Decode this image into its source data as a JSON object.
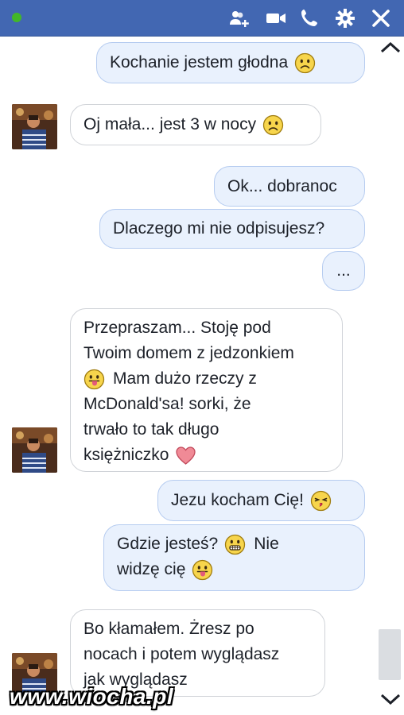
{
  "header": {
    "background": "#4267b2",
    "status_color": "#42b72a",
    "icons": [
      "add-person-icon",
      "video-camera-icon",
      "phone-icon",
      "gear-icon",
      "close-icon"
    ]
  },
  "messages": [
    {
      "from": "me",
      "lines": [
        "Kochanie jestem głodna"
      ],
      "emoji": "sad-face"
    },
    {
      "from": "friend",
      "lines": [
        "Oj mała... jest 3 w nocy"
      ],
      "emoji": "sad-face"
    },
    {
      "from": "me",
      "lines": [
        "Ok... dobranoc"
      ]
    },
    {
      "from": "me",
      "lines": [
        "Dlaczego mi nie odpisujesz?"
      ]
    },
    {
      "from": "me",
      "lines": [
        "..."
      ]
    },
    {
      "from": "friend",
      "lines": [
        "Przepraszam... Stoję pod",
        "Twoim domem z jedzonkiem",
        "Mam dużo rzeczy z",
        "McDonald'sa! sorki, że",
        "trwało to tak długo",
        "księżniczko"
      ],
      "emoji": [
        "tongue-face",
        "heart"
      ]
    },
    {
      "from": "me",
      "lines": [
        "Jezu kocham Cię!"
      ],
      "emoji": "kiss-face"
    },
    {
      "from": "me",
      "lines": [
        "Gdzie jesteś?",
        "Nie",
        "widzę cię"
      ],
      "emoji": [
        "grin-face",
        "tongue-face"
      ]
    },
    {
      "from": "friend",
      "lines": [
        "Bo kłamałem. Żresz po",
        "nocach i potem wyglądasz",
        "jak wyglądasz"
      ]
    }
  ],
  "watermark": "www.wiocha.pl",
  "colors": {
    "outgoing_bubble": "#e9f1fd",
    "outgoing_border": "#b6ccf0",
    "incoming_bubble": "#ffffff",
    "incoming_border": "#d0d3d8"
  }
}
